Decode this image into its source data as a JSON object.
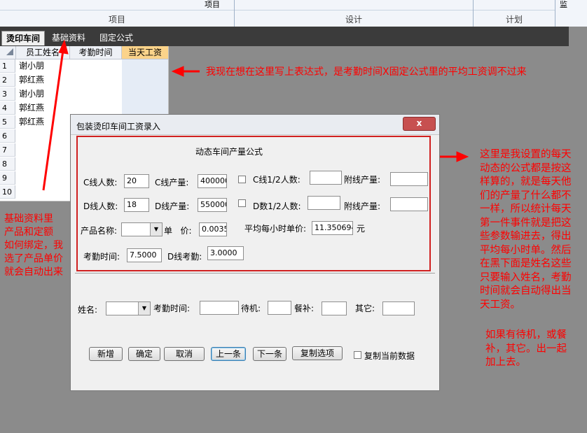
{
  "ribbon": {
    "groups": [
      {
        "label": "项目",
        "top_label": "项目"
      },
      {
        "label": "设计"
      },
      {
        "label": "计划"
      },
      {
        "label": "监"
      }
    ]
  },
  "tabs": [
    "烫印车间",
    "基础资料",
    "固定公式"
  ],
  "grid": {
    "headers": [
      "员工姓名",
      "考勤时间",
      "当天工资"
    ],
    "row_numbers": [
      "1",
      "2",
      "3",
      "4",
      "5",
      "6",
      "7",
      "8",
      "9",
      "10"
    ],
    "names": [
      "谢小朋",
      "郭红燕",
      "谢小朋",
      "郭红燕",
      "郭红燕"
    ]
  },
  "dialog": {
    "title": "包装烫印车间工资录入",
    "close_label": "x",
    "section_title": "动态车间产量公式",
    "c_people_label": "C线人数:",
    "c_people_value": "20",
    "c_output_label": "C线产量:",
    "c_output_value": "400000",
    "c_half_label": "C线1/2人数:",
    "c_half_value": "",
    "c_extra_label": "附线产量:",
    "c_extra_value": "",
    "d_people_label": "D线人数:",
    "d_people_value": "18",
    "d_output_label": "D线产量:",
    "d_output_value": "550000",
    "d_half_label": "D数1/2人数:",
    "d_half_value": "",
    "d_extra_label": "附线产量:",
    "d_extra_value": "",
    "product_label": "产品名称:",
    "product_value": "",
    "price_label": "单   价:",
    "price_value": "0.0035",
    "hourly_label": "平均每小时单价:",
    "hourly_value": "11.350694",
    "unit": "元",
    "att_label": "考勤时间:",
    "att_value": "7.5000",
    "d_att_label": "D线考勤:",
    "d_att_value": "3.0000",
    "name_label": "姓名:",
    "name_value": "",
    "att2_label": "考勤时间:",
    "att2_value": "",
    "standby_label": "待机:",
    "standby_value": "",
    "meal_label": "餐补:",
    "meal_value": "",
    "other_label": "其它:",
    "other_value": "",
    "buttons": {
      "add": "新增",
      "ok": "确定",
      "cancel": "取消",
      "prev": "上一条",
      "next": "下一条",
      "copy": "复制选项"
    },
    "copy_current_label": "复制当前数据"
  },
  "annotations": {
    "top": "我现在想在这里写上表达式，是考勤时间X固定公式里的平均工资调不过来",
    "left": [
      "基础资料里",
      "产品和定额",
      "如何绑定，我",
      "选了产品单价",
      "就会自动出来"
    ],
    "right": [
      "这里是我设置的每天",
      "动态的公式都是按这",
      "样算的，就是每天他",
      "们的产量了什么都不",
      "一样，所以统计每天",
      "第一件事件就是把这",
      "些参数输进去，得出",
      "平均每小时单。然后",
      "在黑下面是姓名这些",
      "只要输入姓名，考勤",
      "时间就会自动得出当",
      "天工资。"
    ],
    "bottom_right": [
      "如果有待机，或餐",
      "补，其它。出一起",
      "加上去。"
    ]
  },
  "colors": {
    "annotation": "#ff0000",
    "dialog_border": "#d02020"
  }
}
